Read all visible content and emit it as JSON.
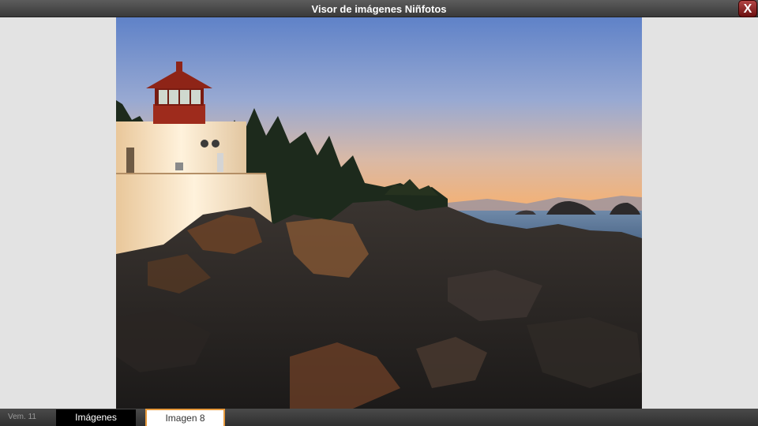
{
  "window": {
    "title": "Visor de imágenes Niñfotos",
    "close_label": "X"
  },
  "viewer": {
    "image_subject": "lighthouse on rocky coast at sunset"
  },
  "status": {
    "version": "Vem. 11",
    "tab_images_label": "Imágenes",
    "tab_current_label": "Imagen  8"
  },
  "colors": {
    "titlebar": "#4a4a4a",
    "close_button": "#8a1f1f",
    "tab_highlight": "#e89a3c"
  }
}
